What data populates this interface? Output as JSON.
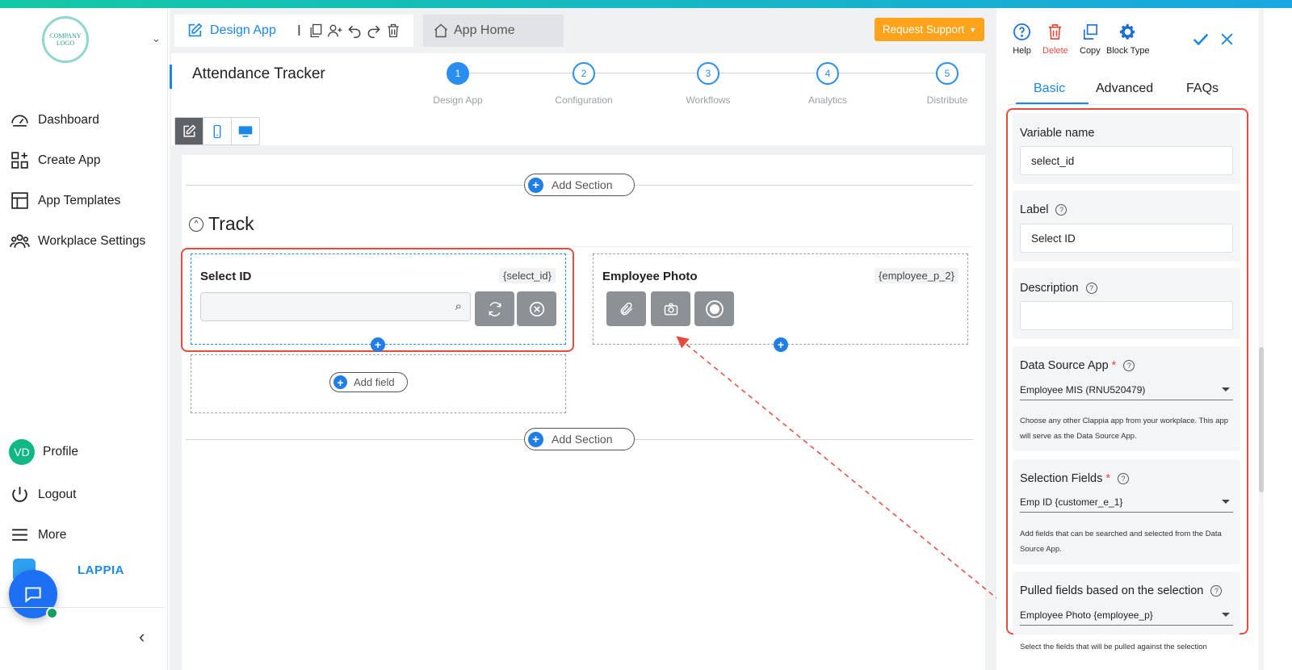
{
  "logo": {
    "text": "COMPANY LOGO"
  },
  "sidebar": {
    "items": [
      {
        "label": "Dashboard",
        "icon": "gauge-icon"
      },
      {
        "label": "Create App",
        "icon": "grid-plus-icon"
      },
      {
        "label": "App Templates",
        "icon": "template-icon"
      },
      {
        "label": "Workplace Settings",
        "icon": "people-icon"
      }
    ],
    "profile": {
      "initials": "VD",
      "label": "Profile"
    },
    "logout": "Logout",
    "more": "More",
    "brand": "LAPPIA"
  },
  "header": {
    "design_tab": "Design App",
    "home_tab": "App Home",
    "request_support": "Request Support",
    "app_title": "Attendance Tracker",
    "steps": [
      {
        "num": "1",
        "label": "Design App",
        "active": true
      },
      {
        "num": "2",
        "label": "Configuration",
        "active": false
      },
      {
        "num": "3",
        "label": "Workflows",
        "active": false
      },
      {
        "num": "4",
        "label": "Analytics",
        "active": false
      },
      {
        "num": "5",
        "label": "Distribute",
        "active": false
      }
    ]
  },
  "canvas": {
    "add_section": "Add Section",
    "section_title": "Track",
    "add_field": "Add field",
    "fields": [
      {
        "label": "Select ID",
        "variable": "{select_id}"
      },
      {
        "label": "Employee Photo",
        "variable": "{employee_p_2}"
      }
    ]
  },
  "panel": {
    "tools": {
      "help": "Help",
      "delete": "Delete",
      "copy": "Copy",
      "block_type": "Block Type"
    },
    "tabs": [
      "Basic",
      "Advanced",
      "FAQs"
    ],
    "variable_name": {
      "label": "Variable name",
      "value": "select_id"
    },
    "field_label": {
      "label": "Label",
      "value": "Select ID"
    },
    "description": {
      "label": "Description",
      "value": ""
    },
    "data_source": {
      "label": "Data Source App",
      "value": "Employee MIS (RNU520479)",
      "help": "Choose any other Clappia app from your workplace. This app will serve as the Data Source App."
    },
    "selection_fields": {
      "label": "Selection Fields",
      "value": "Emp ID {customer_e_1}",
      "help": "Add fields that can be searched and selected from the Data Source App."
    },
    "pulled_fields": {
      "label": "Pulled fields based on the selection",
      "value": "Employee Photo {employee_p}",
      "help": "Select the fields that will be pulled against the selection"
    }
  },
  "colors": {
    "accent": "#1b87e6",
    "warning": "#ffa31a",
    "highlight": "#e64c3c"
  }
}
